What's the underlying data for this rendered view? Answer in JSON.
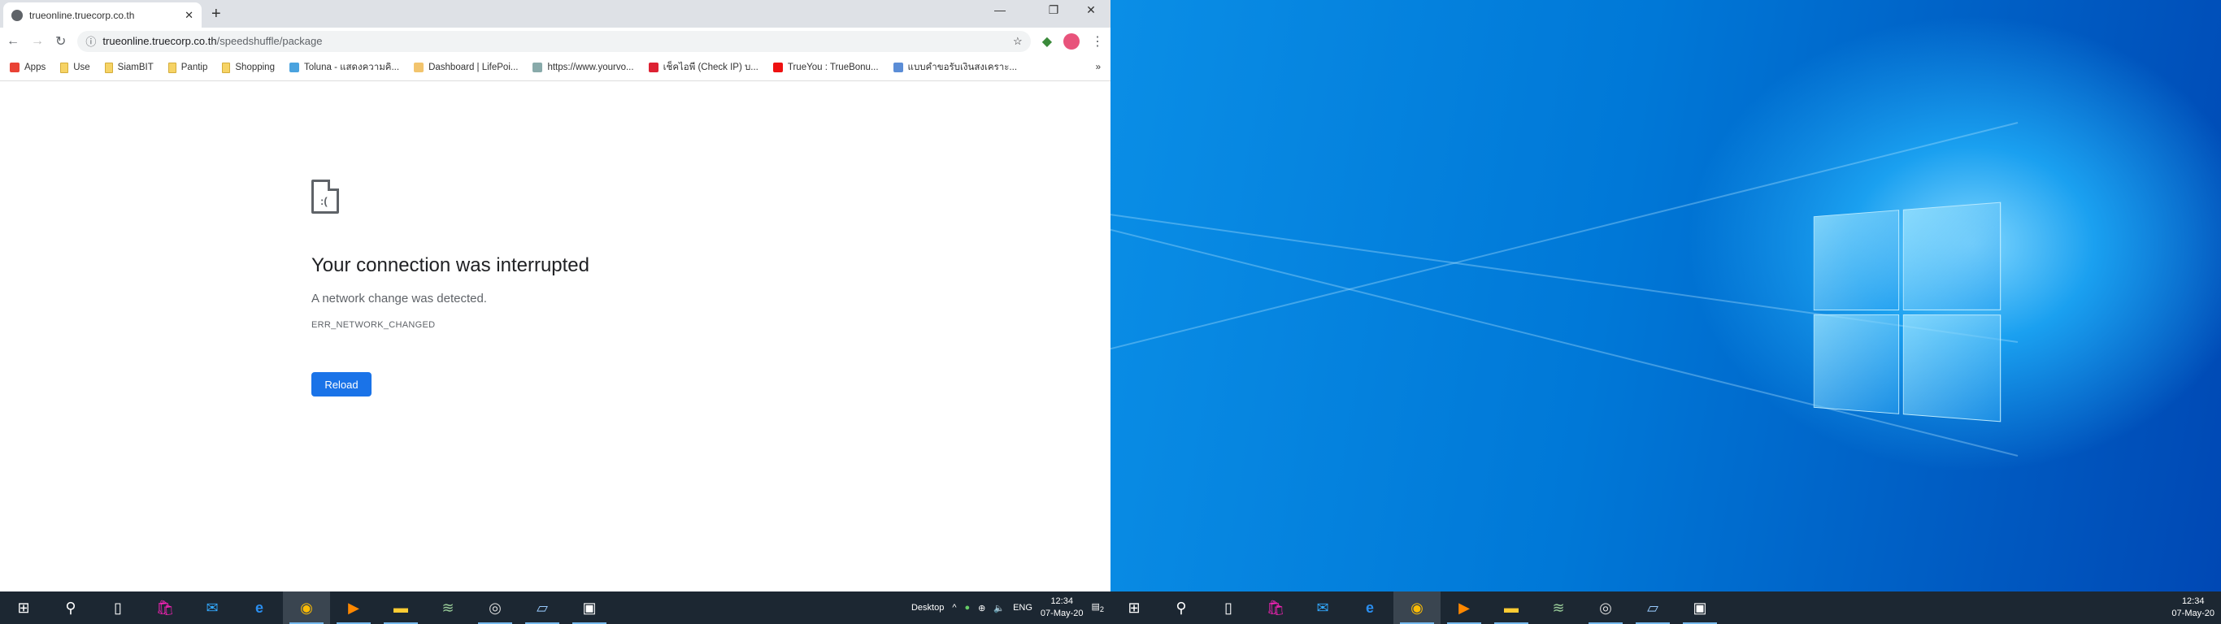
{
  "browser": {
    "tab_title": "trueonline.truecorp.co.th",
    "url_host": "trueonline.truecorp.co.th",
    "url_path": "/speedshuffle/package",
    "bookmarks": [
      {
        "label": "Apps",
        "icon": "apps-grid-icon",
        "color": "#e94235"
      },
      {
        "label": "Use",
        "icon": "folder-icon"
      },
      {
        "label": "SiamBIT",
        "icon": "folder-icon"
      },
      {
        "label": "Pantip",
        "icon": "folder-icon"
      },
      {
        "label": "Shopping",
        "icon": "folder-icon"
      },
      {
        "label": "Toluna - แสดงความคิ...",
        "icon": "toluna-icon",
        "color": "#4aa3df"
      },
      {
        "label": "Dashboard | LifePoi...",
        "icon": "lifepoints-icon",
        "color": "#f2c46d"
      },
      {
        "label": "https://www.yourvo...",
        "icon": "link-icon",
        "color": "#8aa"
      },
      {
        "label": "เช็คไอพี (Check IP) บ...",
        "icon": "map-pin-icon",
        "color": "#d23"
      },
      {
        "label": "TrueYou : TrueBonu...",
        "icon": "heart-icon",
        "color": "#e11"
      },
      {
        "label": "แบบคำขอรับเงินสงเคราะ...",
        "icon": "form-icon",
        "color": "#5b8dd6"
      }
    ],
    "overflow": "»"
  },
  "error": {
    "title": "Your connection was interrupted",
    "message": "A network change was detected.",
    "code": "ERR_NETWORK_CHANGED",
    "reload_label": "Reload"
  },
  "taskbar_left": {
    "desktop_label": "Desktop",
    "lang": "ENG",
    "time": "12:34",
    "date": "07-May-20",
    "notifications": "2"
  },
  "taskbar_right": {
    "time": "12:34",
    "date": "07-May-20"
  },
  "colors": {
    "accent": "#1a73e8",
    "taskbar": "#1c2732"
  }
}
